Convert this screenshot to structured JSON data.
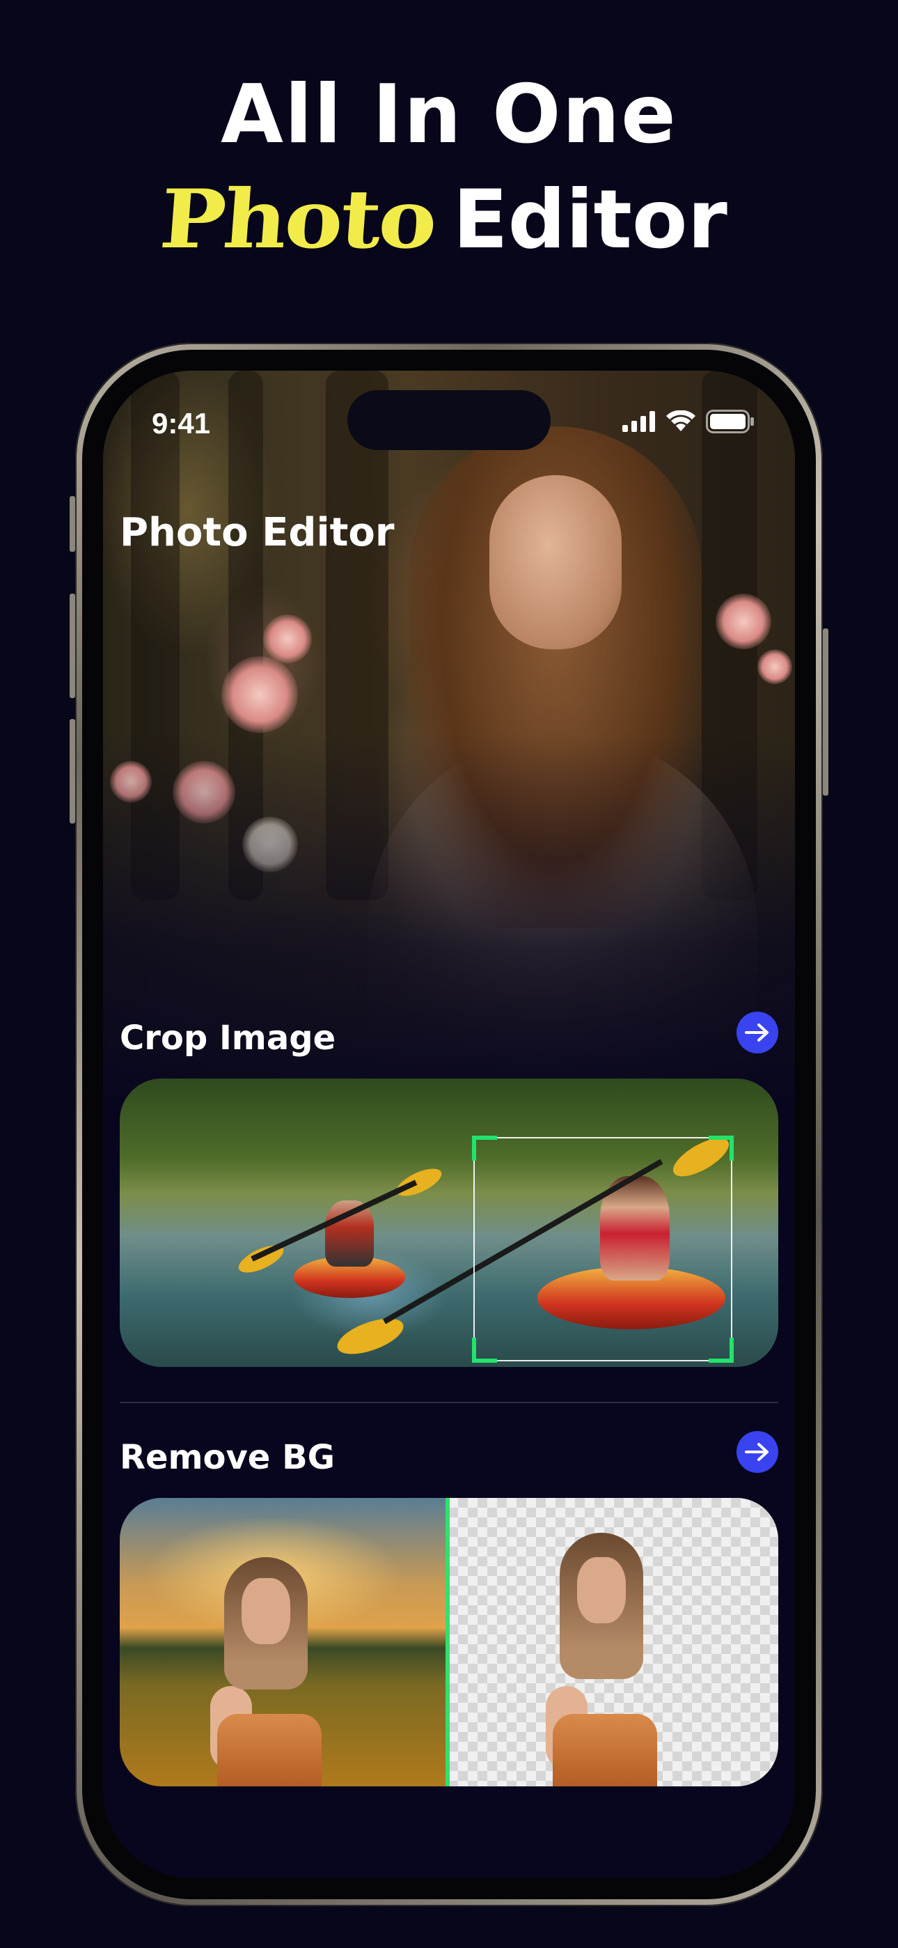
{
  "headline": {
    "line1": "All In One",
    "accent": "Photo",
    "rest": "Editor"
  },
  "status_bar": {
    "time": "9:41",
    "icons": [
      "signal-icon",
      "wifi-icon",
      "battery-icon"
    ]
  },
  "app": {
    "title": "Photo Editor"
  },
  "sections": [
    {
      "title": "Crop Image",
      "icon": "arrow-right-icon"
    },
    {
      "title": "Remove BG",
      "icon": "arrow-right-icon"
    }
  ],
  "colors": {
    "background": "#07061a",
    "accent_yellow": "#f1ec4a",
    "button_blue": "#3a43f0",
    "highlight_green": "#22e36b"
  }
}
